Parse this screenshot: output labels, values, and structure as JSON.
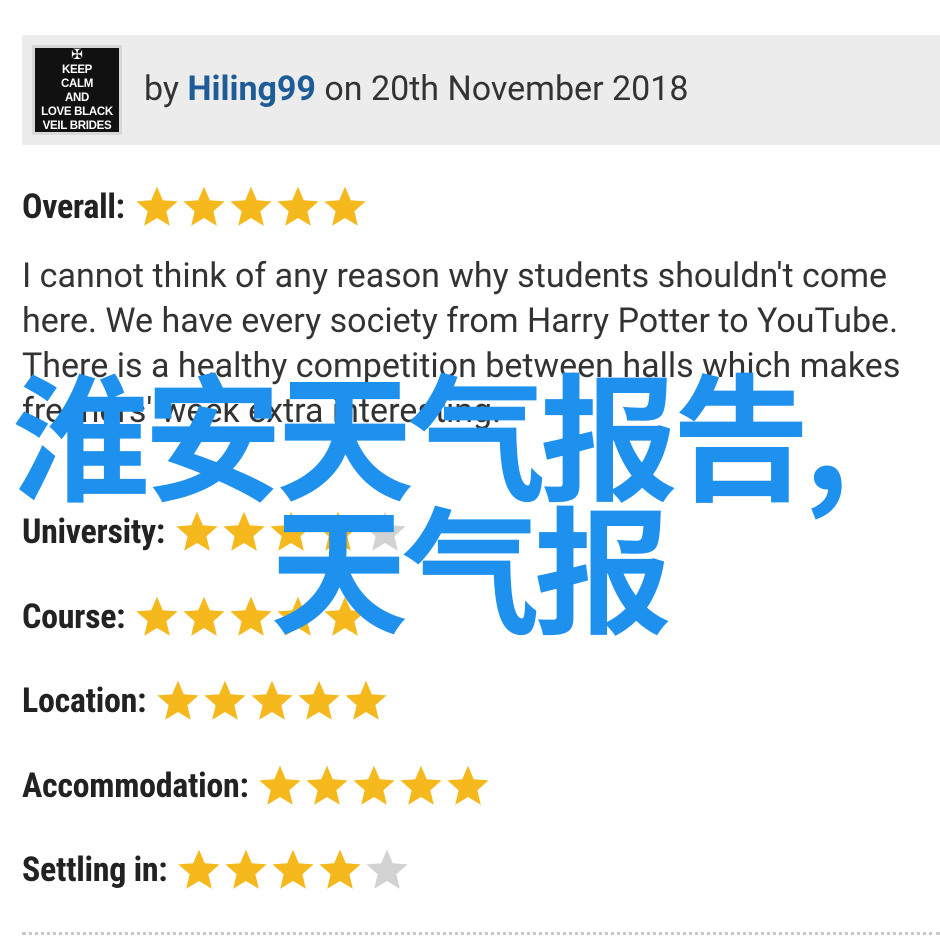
{
  "review": {
    "avatar_lines": [
      "KEEP",
      "CALM",
      "AND",
      "LOVE BLACK",
      "VEIL BRIDES"
    ],
    "by_prefix": "by ",
    "author": "Hiling99",
    "date_text": " on 20th November 2018",
    "overall_label": "Overall:",
    "overall_rating": 5,
    "text": "I cannot think of any reason why students shouldn't come here. We have every society from Harry Potter to YouTube. There is a healthy competition between halls which makes freshers' week extra interesting.",
    "categories": [
      {
        "label": "University:",
        "rating": 4
      },
      {
        "label": "Course:",
        "rating": 5
      },
      {
        "label": "Location:",
        "rating": 5
      },
      {
        "label": "Accommodation:",
        "rating": 5
      },
      {
        "label": "Settling in:",
        "rating": 4
      }
    ]
  },
  "watermark": {
    "line1": "淮安天气报告,",
    "line2": "天气报",
    "color": "#1e90ee"
  },
  "colors": {
    "star_on": "#f5b91e",
    "star_off": "#d2d2d2",
    "author": "#1d5c96",
    "header_bg": "#ececec"
  }
}
